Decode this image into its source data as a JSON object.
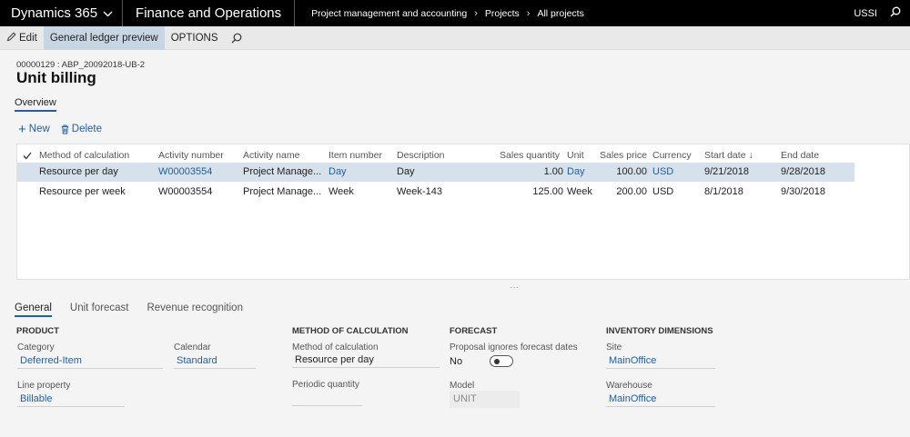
{
  "topbar": {
    "product": "Dynamics 365",
    "app": "Finance and Operations",
    "breadcrumb": [
      "Project management and accounting",
      "Projects",
      "All projects"
    ],
    "company": "USSI"
  },
  "actionbar": {
    "edit": "Edit",
    "gl_preview": "General ledger preview",
    "options": "OPTIONS"
  },
  "header": {
    "record_id": "00000129 : ABP_20092018-UB-2",
    "title": "Unit billing",
    "tab": "Overview"
  },
  "grid_actions": {
    "new": "New",
    "delete": "Delete"
  },
  "grid": {
    "columns": {
      "method": "Method of calculation",
      "activity_number": "Activity number",
      "activity_name": "Activity name",
      "item_number": "Item number",
      "description": "Description",
      "sales_quantity": "Sales quantity",
      "unit": "Unit",
      "sales_price": "Sales price",
      "currency": "Currency",
      "start_date": "Start date ↓",
      "end_date": "End date"
    },
    "rows": [
      {
        "method": "Resource per day",
        "activity_number": "W00003554",
        "activity_name": "Project Manage...",
        "item_number": "Day",
        "description": "Day",
        "sales_quantity": "1.00",
        "unit": "Day",
        "sales_price": "100.00",
        "currency": "USD",
        "start_date": "9/21/2018",
        "end_date": "9/28/2018"
      },
      {
        "method": "Resource per week",
        "activity_number": "W00003554",
        "activity_name": "Project Manage...",
        "item_number": "Week",
        "description": "Week-143",
        "sales_quantity": "125.00",
        "unit": "Week",
        "sales_price": "200.00",
        "currency": "USD",
        "start_date": "8/1/2018",
        "end_date": "9/30/2018"
      }
    ]
  },
  "ellipsis": "···",
  "detail_tabs": [
    "General",
    "Unit forecast",
    "Revenue recognition"
  ],
  "details": {
    "product": {
      "heading": "PRODUCT",
      "category_label": "Category",
      "category_value": "Deferred-Item",
      "calendar_label": "Calendar",
      "calendar_value": "Standard",
      "line_property_label": "Line property",
      "line_property_value": "Billable"
    },
    "method": {
      "heading": "METHOD OF CALCULATION",
      "method_label": "Method of calculation",
      "method_value": "Resource per day",
      "periodic_label": "Periodic quantity",
      "periodic_value": ""
    },
    "forecast": {
      "heading": "FORECAST",
      "proposal_label": "Proposal ignores forecast dates",
      "proposal_value": "No",
      "model_label": "Model",
      "model_value": "UNIT"
    },
    "inventory": {
      "heading": "INVENTORY DIMENSIONS",
      "site_label": "Site",
      "site_value": "MainOffice",
      "warehouse_label": "Warehouse",
      "warehouse_value": "MainOffice"
    }
  },
  "colors": {
    "accent": "#1f5fa8",
    "selected_row": "#d6e1ec",
    "topbar": "#000000"
  },
  "icons": [
    "chevron-down-icon",
    "chevron-right-icon",
    "search-icon",
    "pencil-icon",
    "plus-icon",
    "trash-icon",
    "checkmark-icon"
  ]
}
